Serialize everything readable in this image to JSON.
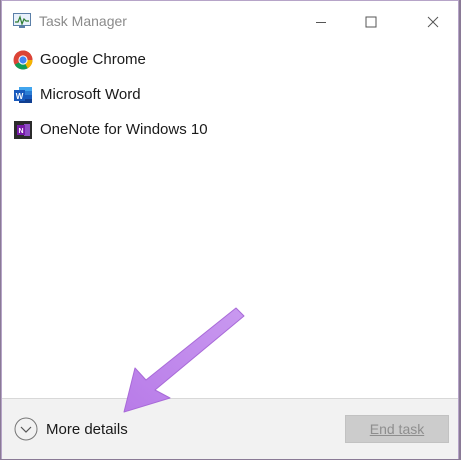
{
  "window": {
    "title": "Task Manager"
  },
  "apps": [
    {
      "name": "Google Chrome",
      "icon": "chrome-icon"
    },
    {
      "name": "Microsoft Word",
      "icon": "word-icon"
    },
    {
      "name": "OneNote for Windows 10",
      "icon": "onenote-icon"
    }
  ],
  "footer": {
    "more_details_label": "More details",
    "end_task_label": "End task"
  },
  "colors": {
    "annotation_arrow": "#b87be8",
    "window_border": "#b6a4c8"
  }
}
